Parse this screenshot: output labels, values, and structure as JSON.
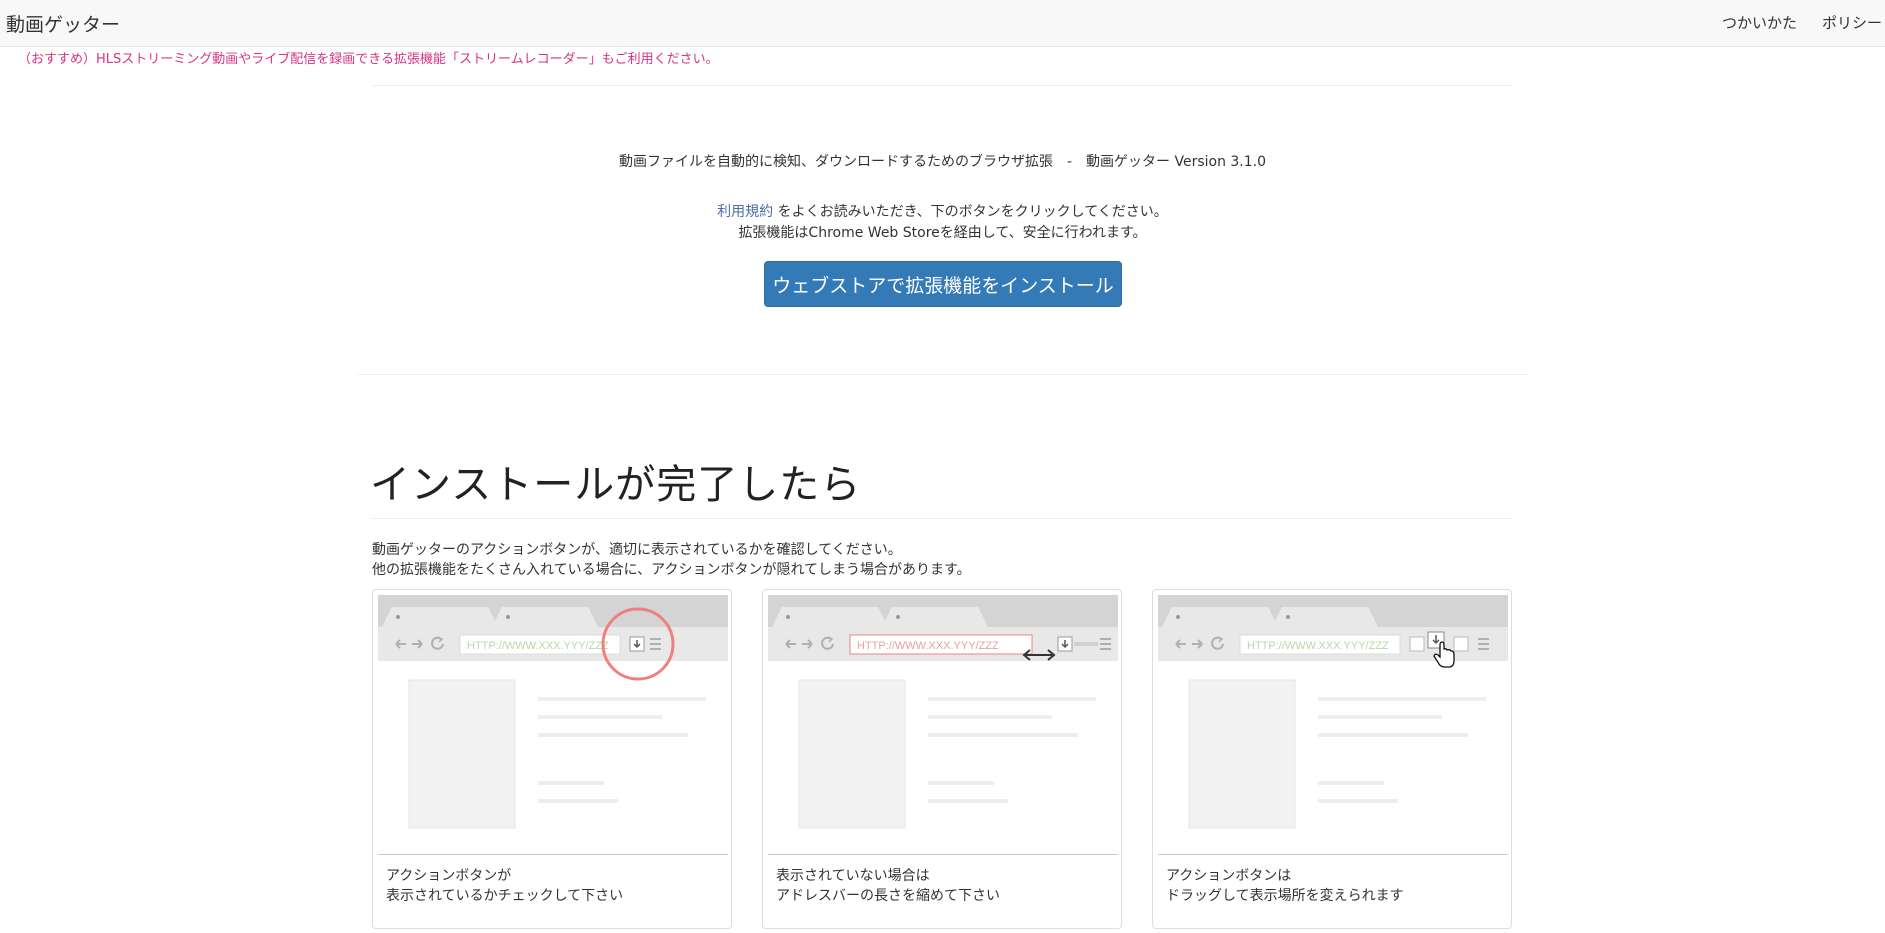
{
  "header": {
    "brand": "動画ゲッター",
    "nav": {
      "how_to": "つかいかた",
      "policy": "ポリシー"
    }
  },
  "notice": "（おすすめ）HLSストリーミング動画やライブ配信を録画できる拡張機能「ストリームレコーダー」もご利用ください。",
  "intro": {
    "description": "動画ファイルを自動的に検知、ダウンロードするためのブラウザ拡張　-　動画ゲッター Version 3.1.0",
    "terms_link": "利用規約",
    "terms_rest": " をよくお読みいただき、下のボタンをクリックしてください。",
    "store_note": "拡張機能はChrome Web Storeを経由して、安全に行われます。",
    "install_button": "ウェブストアで拡張機能をインストール"
  },
  "after_install": {
    "title": "インストールが完了したら",
    "text_1": "動画ゲッターのアクションボタンが、適切に表示されているかを確認してください。",
    "text_2": "他の拡張機能をたくさん入れている場合に、アクションボタンが隠れてしまう場合があります。",
    "cards": [
      {
        "url": "HTTP://WWW.XXX.YYY/ZZZ",
        "caption_1": "アクションボタンが",
        "caption_2": "表示されているかチェックして下さい"
      },
      {
        "url": "HTTP://WWW.XXX.YYY/ZZZ",
        "caption_1": "表示されていない場合は",
        "caption_2": "アドレスバーの長さを縮めて下さい"
      },
      {
        "url": "HTTP://WWW.XXX.YYY/ZZZ",
        "caption_1": "アクションボタンは",
        "caption_2": "ドラッグして表示場所を変えられます"
      }
    ]
  },
  "colors": {
    "navbar_bg": "#f8f8f8",
    "notice": "#d63384",
    "link": "#4a6fa5",
    "button_bg": "#337ab7",
    "button_text": "#ffffff",
    "highlight_circle": "#f08080",
    "url_text": "#b7d9a6"
  },
  "icons": {
    "back": "arrow-left-icon",
    "forward": "arrow-right-icon",
    "reload": "reload-icon",
    "action": "download-icon",
    "menu": "hamburger-menu-icon",
    "resize": "resize-arrows-icon",
    "cursor": "hand-cursor-icon"
  }
}
